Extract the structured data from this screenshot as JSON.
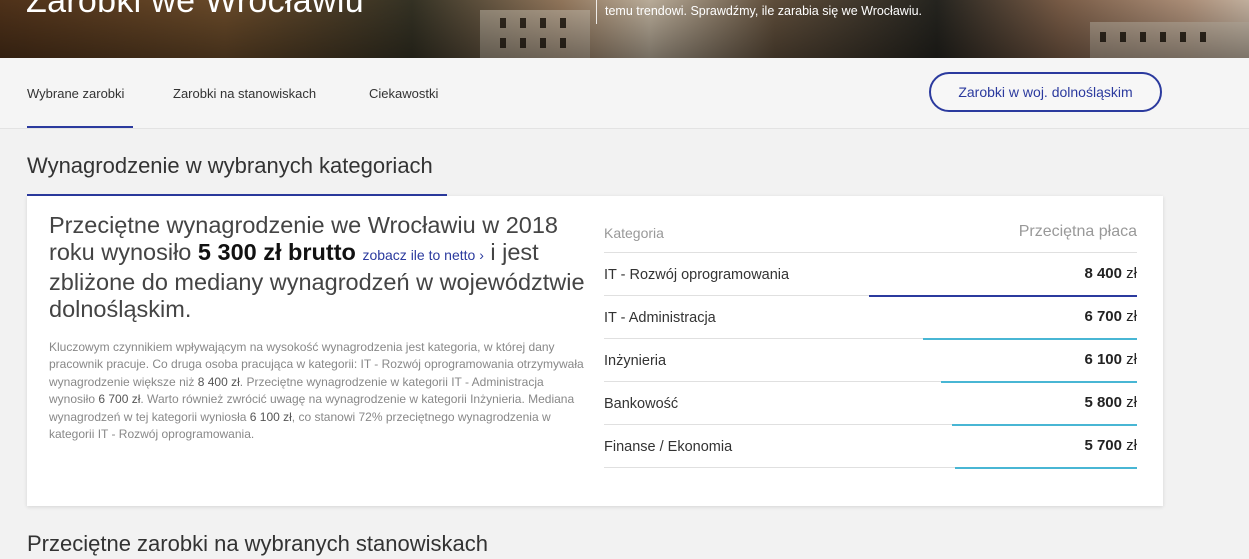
{
  "hero": {
    "title": "Zarobki we Wrocławiu",
    "desc": "temu trendowi. Sprawdźmy, ile zarabia się we Wrocławiu."
  },
  "nav": {
    "tabs": [
      "Wybrane zarobki",
      "Zarobki na stanowiskach",
      "Ciekawostki"
    ],
    "active_tab": "Wybrane zarobki",
    "region_button": "Zarobki w woj. dolnośląskim"
  },
  "section1": {
    "title": "Wynagrodzenie w wybranych kategoriach"
  },
  "section2": {
    "title": "Przeciętne zarobki na wybranych stanowiskach"
  },
  "lead": {
    "part1": "Przeciętne wynagrodzenie we Wrocławiu w 2018 roku wynosiło ",
    "amount": "5 300 zł brutto",
    "link": "zobacz ile to netto ›",
    "part2": " i jest zbliżone do mediany wynagrodzeń w województwie dolnośląskim."
  },
  "body": {
    "t1": "Kluczowym czynnikiem wpływającym na wysokość wynagrodzenia jest kategoria, w której dany pracownik pracuje. Co druga osoba pracująca w kategorii: IT - Rozwój oprogramowania otrzymywała wynagrodzenie większe niż ",
    "v1": "8 400 zł",
    "t2": ". Przeciętne wynagrodzenie w kategorii IT - Administracja wynosiło ",
    "v2": "6 700 zł",
    "t3": ". Warto również zwrócić uwagę na wynagrodzenie w kategorii Inżynieria. Mediana wynagrodzeń w tej kategorii wyniosła ",
    "v3": "6 100 zł",
    "t4": ", co stanowi 72% przeciętnego wynagrodzenia w kategorii IT - Rozwój oprogramowania."
  },
  "table": {
    "col1": "Kategoria",
    "col2": "Przeciętna płaca",
    "currency": "zł",
    "rows": [
      {
        "category": "IT - Rozwój oprogramowania",
        "value": "8 400",
        "bar_fraction": 1.0,
        "bar_color": "#2b3a9e"
      },
      {
        "category": "IT - Administracja",
        "value": "6 700",
        "bar_fraction": 0.8,
        "bar_color": "#48b6d4"
      },
      {
        "category": "Inżynieria",
        "value": "6 100",
        "bar_fraction": 0.73,
        "bar_color": "#48b6d4"
      },
      {
        "category": "Bankowość",
        "value": "5 800",
        "bar_fraction": 0.69,
        "bar_color": "#48b6d4"
      },
      {
        "category": "Finanse / Ekonomia",
        "value": "5 700",
        "bar_fraction": 0.68,
        "bar_color": "#48b6d4"
      }
    ]
  },
  "colors": {
    "accent": "#2b3a9e",
    "bar_secondary": "#48b6d4"
  }
}
